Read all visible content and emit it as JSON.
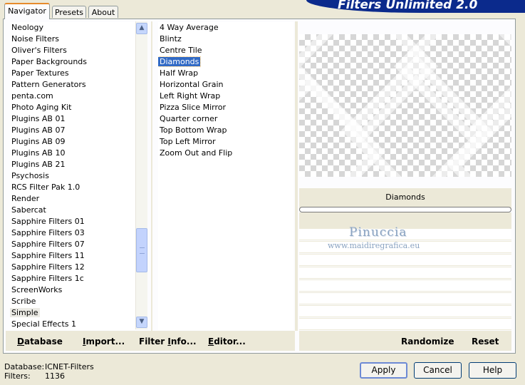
{
  "tabs": [
    {
      "label": "Navigator"
    },
    {
      "label": "Presets"
    },
    {
      "label": "About"
    }
  ],
  "banner_title": "Filters Unlimited 2.0",
  "categories": [
    "Neology",
    "Noise Filters",
    "Oliver's Filters",
    "Paper Backgrounds",
    "Paper Textures",
    "Pattern Generators",
    "penta.com",
    "Photo Aging Kit",
    "Plugins AB 01",
    "Plugins AB 07",
    "Plugins AB 09",
    "Plugins AB 10",
    "Plugins AB 21",
    "Psychosis",
    "RCS Filter Pak 1.0",
    "Render",
    "Sabercat",
    "Sapphire Filters 01",
    "Sapphire Filters 03",
    "Sapphire Filters 07",
    "Sapphire Filters 11",
    "Sapphire Filters 12",
    "Sapphire Filters 1c",
    "ScreenWorks",
    "Scribe",
    "Simple",
    "Special Effects 1"
  ],
  "selected_category": "Simple",
  "filters": [
    "4 Way Average",
    "Blintz",
    "Centre Tile",
    "Diamonds",
    "Half Wrap",
    "Horizontal Grain",
    "Left Right Wrap",
    "Pizza Slice Mirror",
    "Quarter corner",
    "Top Bottom Wrap",
    "Top Left Mirror",
    "Zoom Out and Flip"
  ],
  "selected_filter": "Diamonds",
  "scroll_position": 0.82,
  "preview_caption": "Diamonds",
  "watermark": {
    "name": "Pinuccia",
    "url": "www.maidiregrafica.eu"
  },
  "toolbar": {
    "database_label": "Database",
    "import_label": "Import...",
    "filter_info_label": "Filter Info...",
    "editor_label": "Editor...",
    "randomize_label": "Randomize",
    "reset_label": "Reset"
  },
  "status": {
    "database_key": "Database:",
    "database_value": "ICNET-Filters",
    "filters_key": "Filters:",
    "filters_value": "1136"
  },
  "buttons": {
    "apply": "Apply",
    "cancel": "Cancel",
    "help": "Help"
  },
  "colors": {
    "selection": "#316ac5",
    "banner": "#0b2a8c",
    "window": "#ece9d8"
  }
}
